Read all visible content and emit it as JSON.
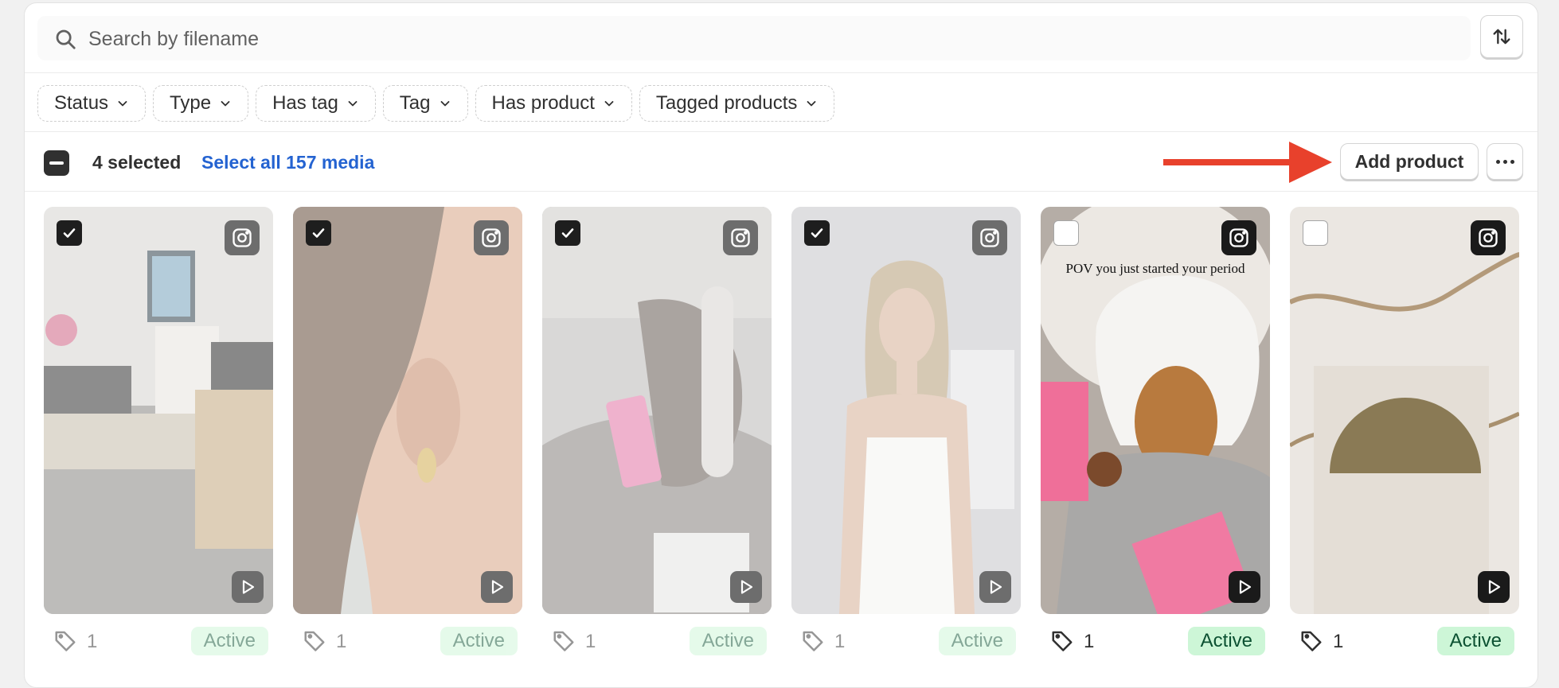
{
  "search": {
    "placeholder": "Search by filename"
  },
  "icons": {
    "search": "search-icon",
    "sort": "sort-arrows-icon",
    "chevron": "chevron-down-icon",
    "more": "more-horizontal-icon",
    "instagram": "instagram-icon",
    "play": "play-icon",
    "tag": "tag-icon",
    "checkmark": "checkmark-icon"
  },
  "filters": [
    "Status",
    "Type",
    "Has tag",
    "Tag",
    "Has product",
    "Tagged products"
  ],
  "bulk": {
    "selected_label": "4 selected",
    "select_all_label": "Select all 157 media",
    "add_product_label": "Add product"
  },
  "colors": {
    "link": "#2463d1",
    "arrow": "#e8412c",
    "status_bg": "#cdf6d7",
    "status_text": "#0c5132"
  },
  "media": [
    {
      "selected": true,
      "tag_count": "1",
      "status": "Active",
      "overlay_text": ""
    },
    {
      "selected": true,
      "tag_count": "1",
      "status": "Active",
      "overlay_text": ""
    },
    {
      "selected": true,
      "tag_count": "1",
      "status": "Active",
      "overlay_text": ""
    },
    {
      "selected": true,
      "tag_count": "1",
      "status": "Active",
      "overlay_text": ""
    },
    {
      "selected": false,
      "tag_count": "1",
      "status": "Active",
      "overlay_text": "POV you just started your period"
    },
    {
      "selected": false,
      "tag_count": "1",
      "status": "Active",
      "overlay_text": ""
    }
  ]
}
